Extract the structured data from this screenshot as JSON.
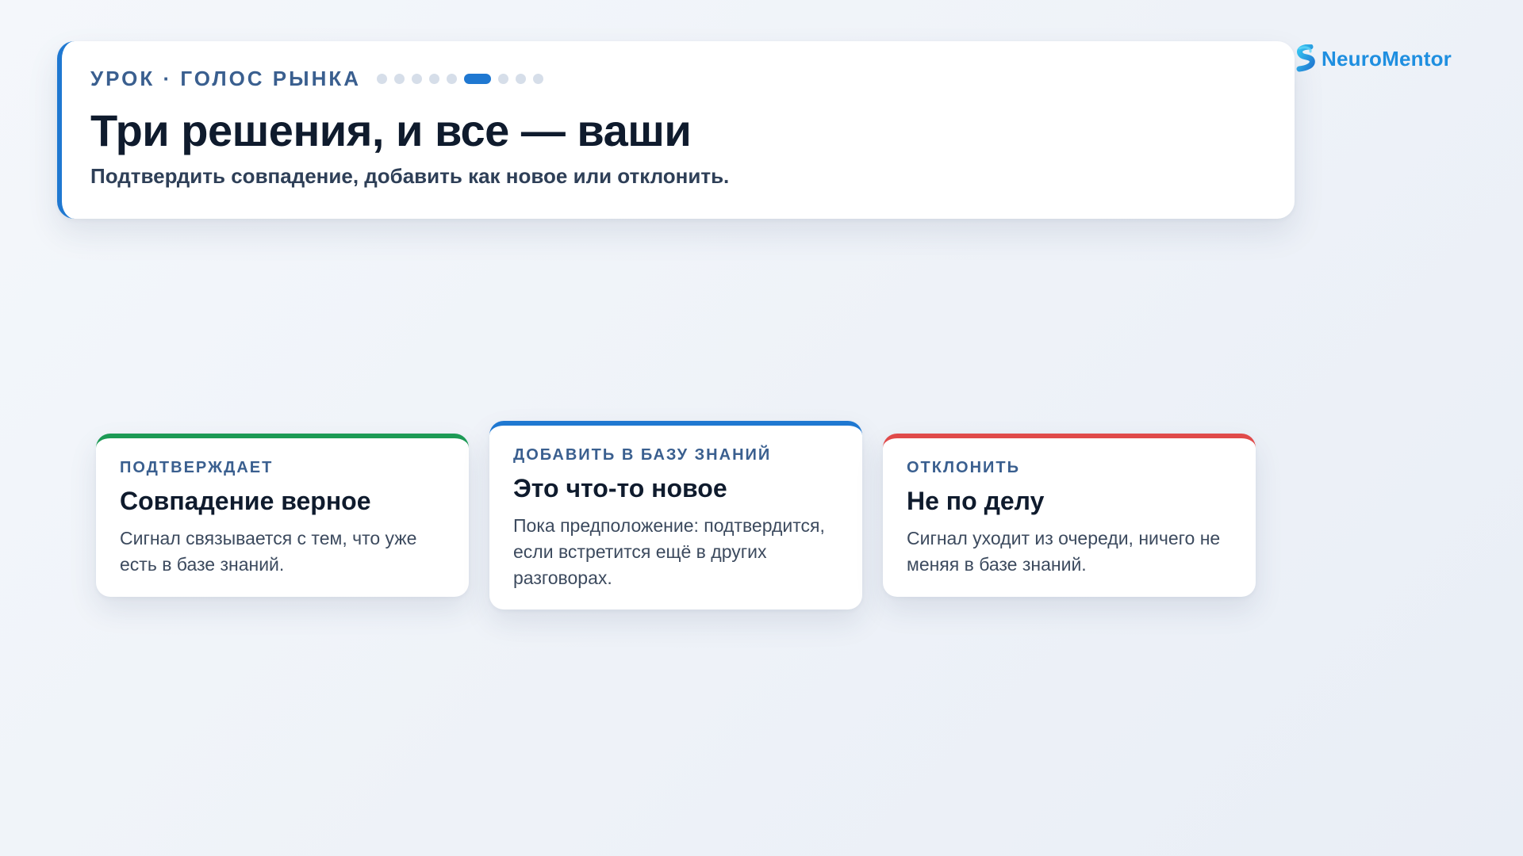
{
  "header": {
    "eyebrow": "УРОК · ГОЛОС РЫНКА",
    "title": "Три решения, и все — ваши",
    "subtitle": "Подтвердить совпадение, добавить как новое или отклонить.",
    "progress": {
      "total_steps": 10,
      "current_step": 6
    }
  },
  "brand": {
    "name": "NeuroMentor",
    "logo_icon": "neuromentor-logo-icon",
    "color": "#1f8fe0"
  },
  "options": [
    {
      "eyebrow": "ПОДТВЕРЖДАЕТ",
      "title": "Совпадение верное",
      "text": "Сигнал связывается с тем, что уже есть в базе знаний.",
      "accent": "#1c9a55"
    },
    {
      "eyebrow": "ДОБАВИТЬ В БАЗУ ЗНАНИЙ",
      "title": "Это что-то новое",
      "text": "Пока предположение: подтвердится, если встретится ещё в других разговорах.",
      "accent": "#1f78d1"
    },
    {
      "eyebrow": "ОТКЛОНИТЬ",
      "title": "Не по делу",
      "text": "Сигнал уходит из очереди, ничего не меняя в базе знаний.",
      "accent": "#e04a4a"
    }
  ],
  "colors": {
    "primary_accent": "#1f78d1",
    "eyebrow_text": "#3a5f8f",
    "heading_text": "#0f1b2d"
  }
}
